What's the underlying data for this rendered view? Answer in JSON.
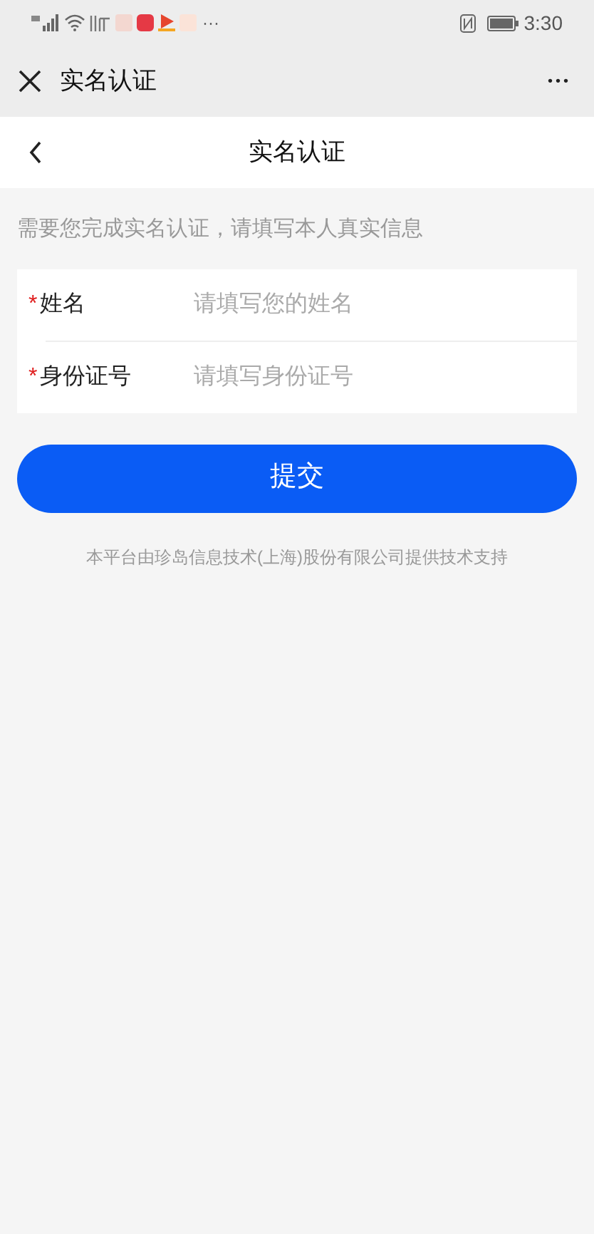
{
  "status_bar": {
    "more": "···",
    "time": "3:30"
  },
  "app_bar": {
    "title": "实名认证",
    "more": "•••"
  },
  "header": {
    "title": "实名认证"
  },
  "notice": "需要您完成实名认证，请填写本人真实信息",
  "fields": [
    {
      "label": "姓名",
      "required_mark": "*",
      "placeholder": "请填写您的姓名"
    },
    {
      "label": "身份证号",
      "required_mark": "*",
      "placeholder": "请填写身份证号"
    }
  ],
  "submit": "提交",
  "footer": "本平台由珍岛信息技术(上海)股份有限公司提供技术支持"
}
